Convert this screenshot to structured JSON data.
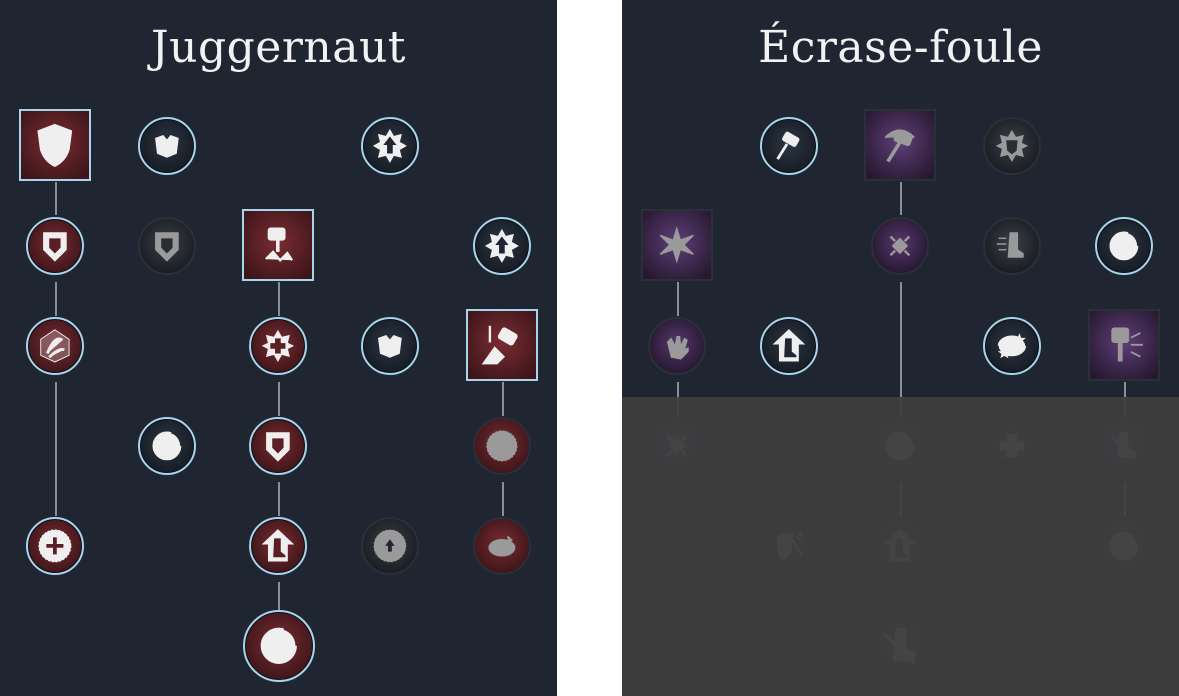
{
  "trees": [
    {
      "title": "Juggernaut"
    },
    {
      "title": "Écrase-foule"
    }
  ],
  "icons": {
    "shield": "shield-icon",
    "armor": "armor-icon",
    "burst": "burst-arrow-icon",
    "hammer": "hammer-icon",
    "spin": "spin-icon",
    "heal": "heal-cross-icon",
    "boot": "boot-icon",
    "hand": "hand-icon"
  },
  "colors": {
    "panel_bg": "#1f2632",
    "active_ring": "#a8d4ec",
    "juggernaut_node": "#7a2c32",
    "ecrase_node": "#58386e",
    "connector": "#8a8f96",
    "dim_overlay": "#3e3e3e"
  }
}
